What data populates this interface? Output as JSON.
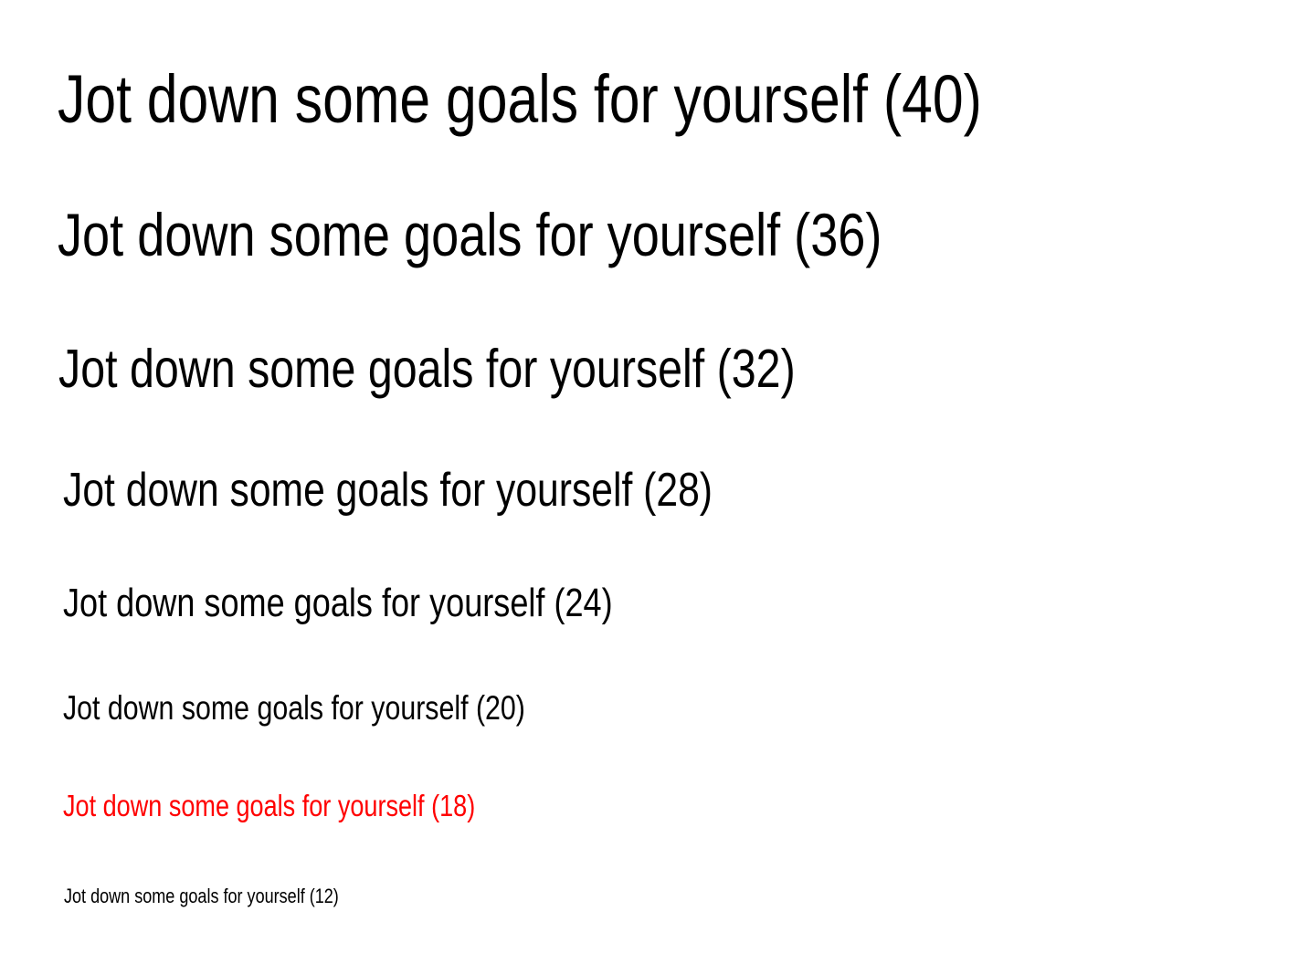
{
  "samples": [
    {
      "text": "Jot down some goals for yourself (40)",
      "color": "#000000"
    },
    {
      "text": "Jot down some goals for yourself (36)",
      "color": "#000000"
    },
    {
      "text": "Jot down some goals for yourself (32)",
      "color": "#000000"
    },
    {
      "text": "Jot down some goals for yourself (28)",
      "color": "#000000"
    },
    {
      "text": "Jot down some goals for yourself (24)",
      "color": "#000000"
    },
    {
      "text": "Jot down some goals for yourself (20)",
      "color": "#000000"
    },
    {
      "text": "Jot down some goals for yourself (18)",
      "color": "#ff0000"
    },
    {
      "text": "Jot down some goals for yourself (12)",
      "color": "#000000"
    }
  ]
}
